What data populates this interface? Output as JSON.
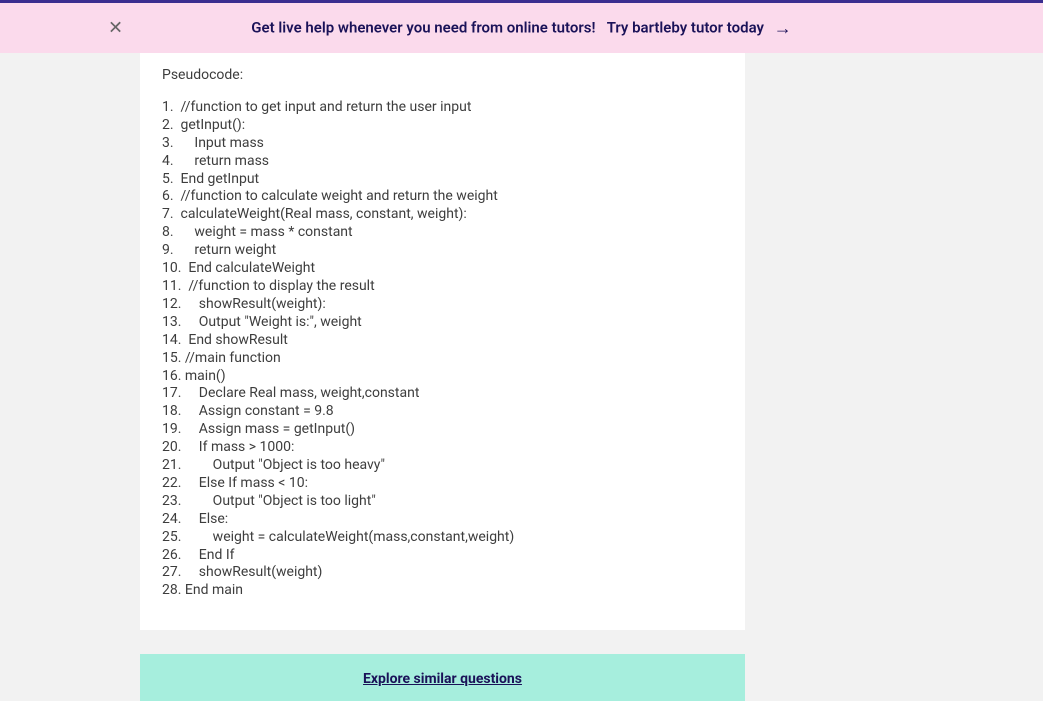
{
  "banner": {
    "text_main": "Get live help whenever you need from online tutors!",
    "text_cta": "Try bartleby tutor today",
    "arrow": "→"
  },
  "code": {
    "title": "Pseudocode:",
    "lines": [
      "1.  //function to get input and return the user input",
      "2.  getInput():",
      "3.      Input mass",
      "4.      return mass",
      "5.  End getInput",
      "6.  //function to calculate weight and return the weight",
      "7.  calculateWeight(Real mass, constant, weight):",
      "8.      weight = mass * constant",
      "9.      return weight",
      "10.  End calculateWeight",
      "11.  //function to display the result",
      "12.     showResult(weight):",
      "13.     Output \"Weight is:\", weight",
      "14.  End showResult",
      "15. //main function",
      "16. main()",
      "17.     Declare Real mass, weight,constant",
      "18.     Assign constant = 9.8",
      "19.     Assign mass = getInput()",
      "20.     If mass > 1000:",
      "21.         Output \"Object is too heavy\"",
      "22.     Else If mass < 10:",
      "23.         Output \"Object is too light\"",
      "24.     Else:",
      "25.         weight = calculateWeight(mass,constant,weight)",
      "26.     End If",
      "27.     showResult(weight)",
      "28. End main"
    ]
  },
  "explore": {
    "link_text": "Explore similar questions"
  }
}
